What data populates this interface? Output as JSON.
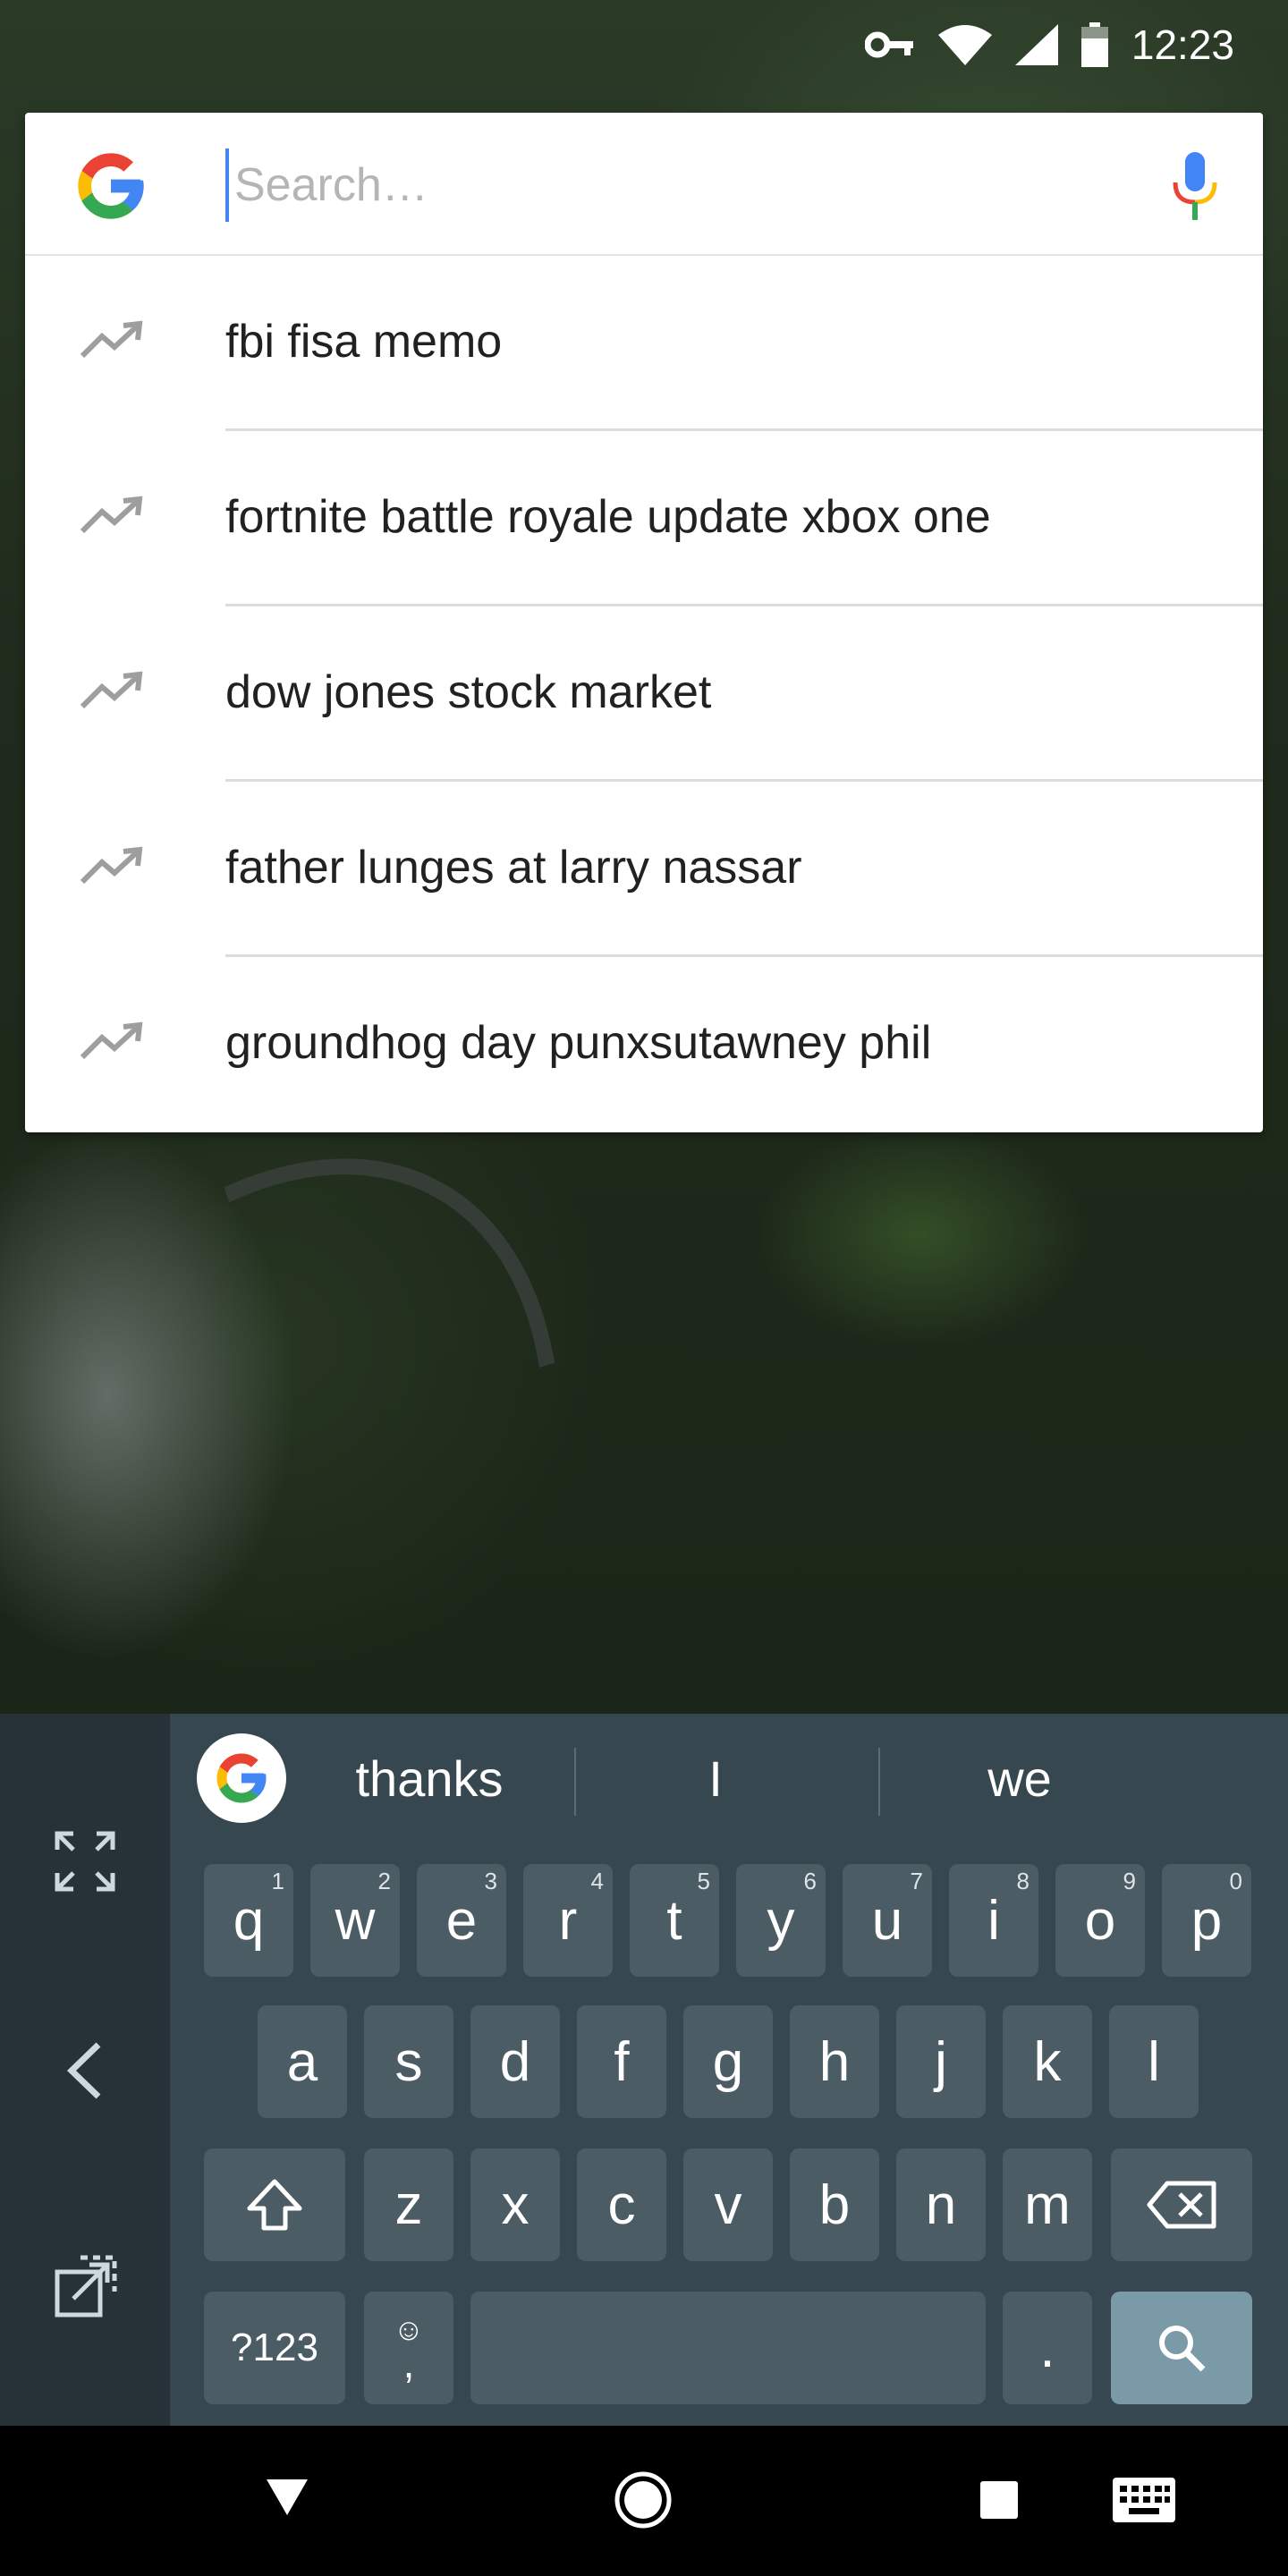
{
  "status_bar": {
    "time": "12:23",
    "icons": [
      "vpn-key-icon",
      "wifi-icon",
      "cell-signal-icon",
      "battery-icon"
    ]
  },
  "search": {
    "placeholder": "Search…",
    "value": "",
    "suggestions": [
      {
        "text": "fbi fisa memo",
        "icon": "trending-up-icon"
      },
      {
        "text": "fortnite battle royale update xbox one",
        "icon": "trending-up-icon"
      },
      {
        "text": "dow jones stock market",
        "icon": "trending-up-icon"
      },
      {
        "text": "father lunges at larry nassar",
        "icon": "trending-up-icon"
      },
      {
        "text": "groundhog day punxsutawney phil",
        "icon": "trending-up-icon"
      }
    ]
  },
  "keyboard": {
    "word_suggestions": [
      "thanks",
      "I",
      "we"
    ],
    "row1": [
      {
        "key": "q",
        "hint": "1"
      },
      {
        "key": "w",
        "hint": "2"
      },
      {
        "key": "e",
        "hint": "3"
      },
      {
        "key": "r",
        "hint": "4"
      },
      {
        "key": "t",
        "hint": "5"
      },
      {
        "key": "y",
        "hint": "6"
      },
      {
        "key": "u",
        "hint": "7"
      },
      {
        "key": "i",
        "hint": "8"
      },
      {
        "key": "o",
        "hint": "9"
      },
      {
        "key": "p",
        "hint": "0"
      }
    ],
    "row2": [
      "a",
      "s",
      "d",
      "f",
      "g",
      "h",
      "j",
      "k",
      "l"
    ],
    "row3": [
      "z",
      "x",
      "c",
      "v",
      "b",
      "n",
      "m"
    ],
    "symbols_label": "?123",
    "comma_label": ",",
    "period_label": ".",
    "side_icons": [
      "expand-icon",
      "back-arrow-icon",
      "popout-icon"
    ]
  },
  "nav_bar": {
    "icons": [
      "back-triangle-icon",
      "home-circle-icon",
      "recents-square-icon",
      "keyboard-icon"
    ]
  },
  "colors": {
    "google_blue": "#4285F4",
    "google_red": "#EA4335",
    "google_yellow": "#FBBC05",
    "google_green": "#34A853",
    "keyboard_bg": "#37474F",
    "key_bg": "#4B5C64",
    "search_key_bg": "#7B9AA8"
  }
}
